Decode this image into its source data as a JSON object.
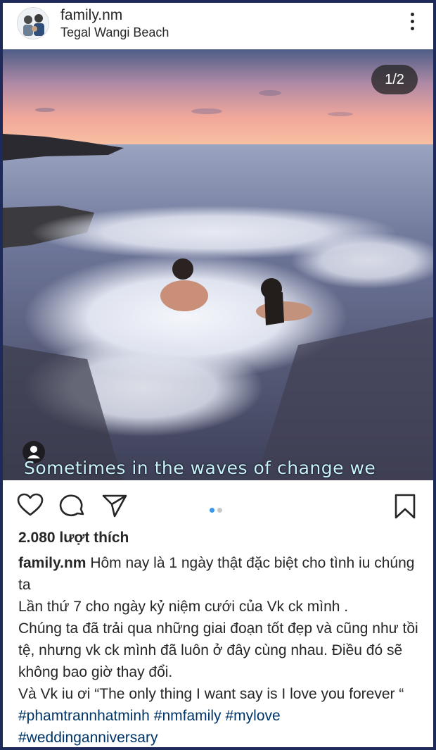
{
  "post": {
    "username": "family.nm",
    "location": "Tegal Wangi Beach",
    "counter": "1/2",
    "overlay_text": "Sometimes in the waves of change we",
    "likes": "2.080 lượt thích",
    "caption_first": "Hôm nay là 1 ngày thật đặc biệt cho tình iu chúng ta",
    "caption_lines": [
      "Lần thứ 7 cho ngày kỷ niệm cưới của Vk ck mình .",
      "Chúng ta đã trải qua những giai đoạn tốt đẹp và cũng như tồi tệ, nhưng vk ck mình đã luôn ở đây cùng nhau. Điều đó sẽ không bao giờ thay đổi.",
      "Và Vk iu ơi “The only thing I want say is I love you forever “"
    ],
    "hashtags": [
      "#phamtrannhatminh",
      "#nmfamily",
      "#mylove",
      "#weddinganniversary"
    ]
  },
  "carousel": {
    "total": 2,
    "active": 1
  },
  "icons": {
    "more": "more-vertical-icon",
    "like": "heart-icon",
    "comment": "comment-bubble-icon",
    "share": "paper-plane-icon",
    "save": "bookmark-icon",
    "tagged": "user-tag-icon"
  },
  "colors": {
    "frame": "#1e2a5a",
    "hashtag": "#003569",
    "active_dot": "#3897f0"
  }
}
